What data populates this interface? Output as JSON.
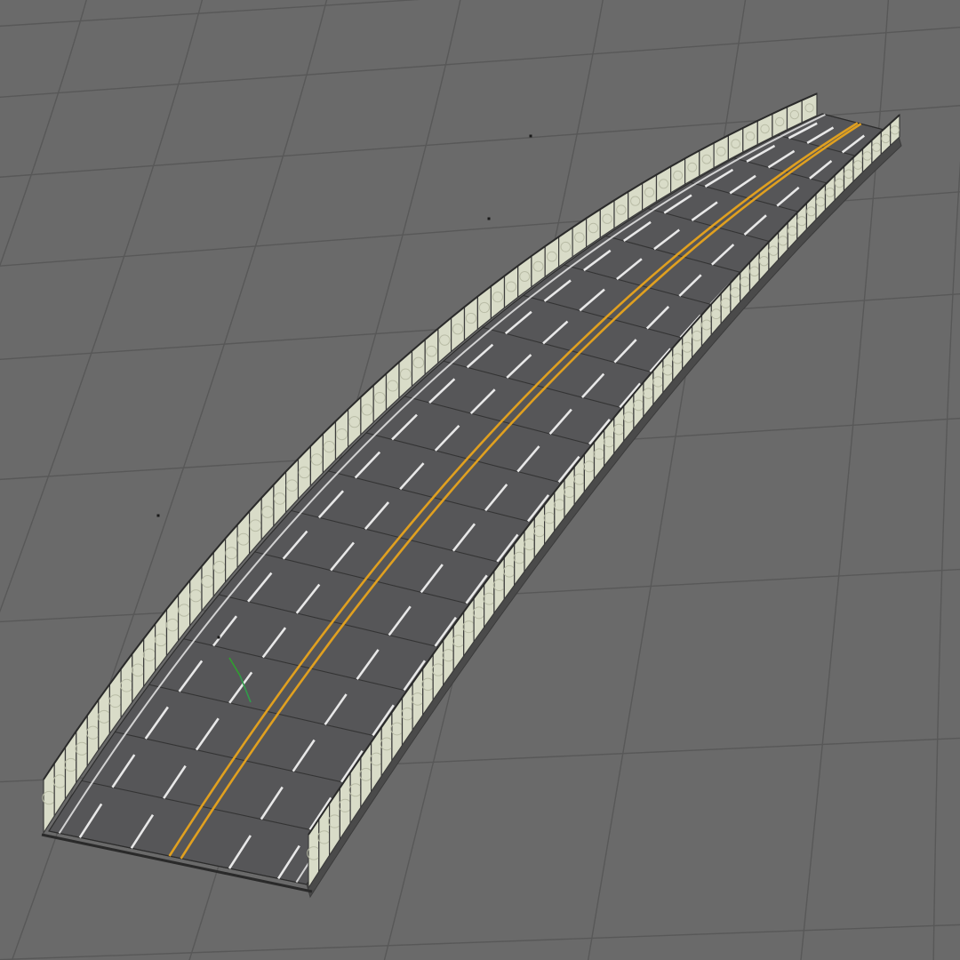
{
  "viewport": {
    "view": "perspective",
    "background_color": "#6a6a6a",
    "grid_visible": true,
    "grid_color": "#585858"
  },
  "model": {
    "name": "curved-highway-segment",
    "road_surface_color": "#565658",
    "center_line_color": "#e0a020",
    "lane_marking_color": "#e8e8e8",
    "barrier_color": "#d9dcc8",
    "barrier_edge_color": "#3c3c3c",
    "center_line_count": 2,
    "lanes_per_direction": 2,
    "selected": false
  },
  "gizmo": {
    "visible": true,
    "axis_colors": [
      "#2fa02f",
      "#2f9d4a"
    ]
  },
  "vertex_markers": {
    "visible": true,
    "color": "#1a1a1a"
  }
}
